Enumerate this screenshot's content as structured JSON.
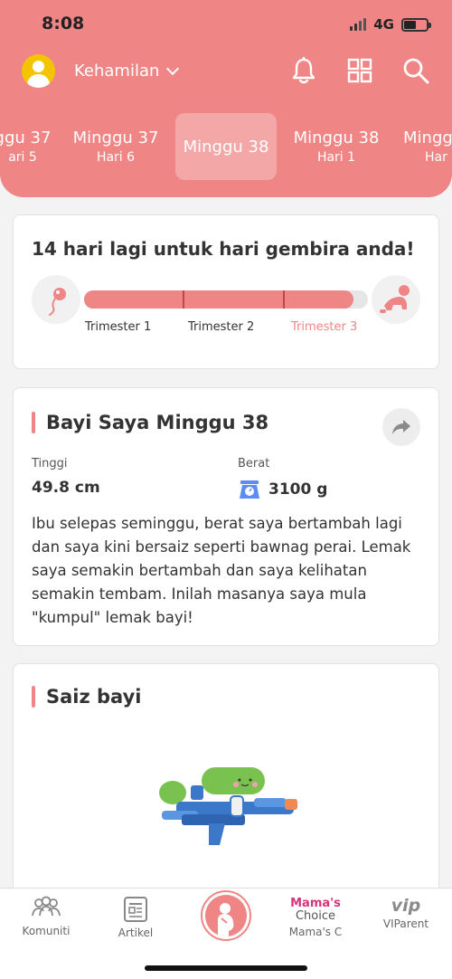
{
  "status_bar": {
    "time": "8:08",
    "network": "4G"
  },
  "header": {
    "title": "Kehamilan"
  },
  "week_tabs": [
    {
      "line1": "ggu 37",
      "line2": "ari 5"
    },
    {
      "line1": "Minggu 37",
      "line2": "Hari 6"
    },
    {
      "line1": "Minggu 38",
      "line2": ""
    },
    {
      "line1": "Minggu 38",
      "line2": "Hari 1"
    },
    {
      "line1": "Mingg",
      "line2": "Har"
    }
  ],
  "countdown_card": {
    "title": "14 hari lagi untuk hari gembira anda!",
    "progress_fraction": 0.95,
    "trimesters": [
      "Trimester 1",
      "Trimester 2",
      "Trimester 3"
    ]
  },
  "baby_card": {
    "title": "Bayi Saya  Minggu 38",
    "height_label": "Tinggi",
    "height_value": "49.8 cm",
    "weight_label": "Berat",
    "weight_value": "3100 g",
    "description": "Ibu selepas seminggu, berat saya bertambah lagi dan saya kini bersaiz seperti bawnag perai. Lemak saya semakin bertambah dan saya kelihatan semakin tembam. Inilah masanya saya mula \"kumpul\" lemak bayi!"
  },
  "size_card": {
    "title": "Saiz bayi"
  },
  "bottom_nav": {
    "community": "Komuniti",
    "articles": "Artikel",
    "mamas_logo_line1": "Mama's",
    "mamas_logo_line2": "Choice",
    "mamas": "Mama's C",
    "vip_logo": "vip",
    "vip": "VIParent"
  },
  "colors": {
    "brand": "#ef8585",
    "accent_dark": "#c0464d",
    "weight_icon": "#5b8ef0"
  }
}
